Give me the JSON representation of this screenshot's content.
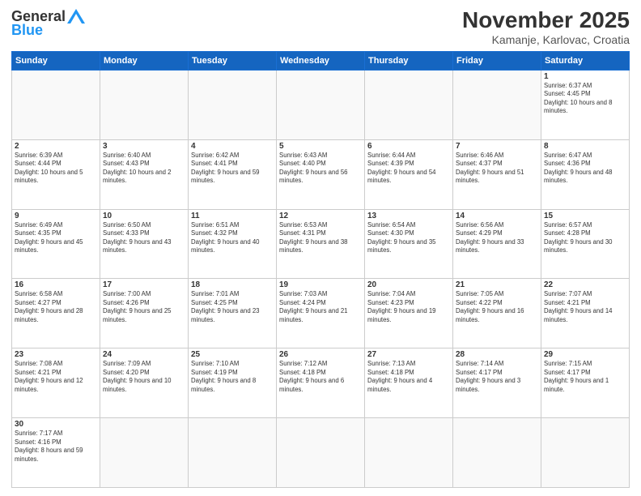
{
  "logo": {
    "general": "General",
    "blue": "Blue"
  },
  "title": {
    "month": "November 2025",
    "location": "Kamanje, Karlovac, Croatia"
  },
  "weekdays": [
    "Sunday",
    "Monday",
    "Tuesday",
    "Wednesday",
    "Thursday",
    "Friday",
    "Saturday"
  ],
  "weeks": [
    [
      {
        "day": "",
        "info": ""
      },
      {
        "day": "",
        "info": ""
      },
      {
        "day": "",
        "info": ""
      },
      {
        "day": "",
        "info": ""
      },
      {
        "day": "",
        "info": ""
      },
      {
        "day": "",
        "info": ""
      },
      {
        "day": "1",
        "info": "Sunrise: 6:37 AM\nSunset: 4:45 PM\nDaylight: 10 hours and 8 minutes."
      }
    ],
    [
      {
        "day": "2",
        "info": "Sunrise: 6:39 AM\nSunset: 4:44 PM\nDaylight: 10 hours and 5 minutes."
      },
      {
        "day": "3",
        "info": "Sunrise: 6:40 AM\nSunset: 4:43 PM\nDaylight: 10 hours and 2 minutes."
      },
      {
        "day": "4",
        "info": "Sunrise: 6:42 AM\nSunset: 4:41 PM\nDaylight: 9 hours and 59 minutes."
      },
      {
        "day": "5",
        "info": "Sunrise: 6:43 AM\nSunset: 4:40 PM\nDaylight: 9 hours and 56 minutes."
      },
      {
        "day": "6",
        "info": "Sunrise: 6:44 AM\nSunset: 4:39 PM\nDaylight: 9 hours and 54 minutes."
      },
      {
        "day": "7",
        "info": "Sunrise: 6:46 AM\nSunset: 4:37 PM\nDaylight: 9 hours and 51 minutes."
      },
      {
        "day": "8",
        "info": "Sunrise: 6:47 AM\nSunset: 4:36 PM\nDaylight: 9 hours and 48 minutes."
      }
    ],
    [
      {
        "day": "9",
        "info": "Sunrise: 6:49 AM\nSunset: 4:35 PM\nDaylight: 9 hours and 45 minutes."
      },
      {
        "day": "10",
        "info": "Sunrise: 6:50 AM\nSunset: 4:33 PM\nDaylight: 9 hours and 43 minutes."
      },
      {
        "day": "11",
        "info": "Sunrise: 6:51 AM\nSunset: 4:32 PM\nDaylight: 9 hours and 40 minutes."
      },
      {
        "day": "12",
        "info": "Sunrise: 6:53 AM\nSunset: 4:31 PM\nDaylight: 9 hours and 38 minutes."
      },
      {
        "day": "13",
        "info": "Sunrise: 6:54 AM\nSunset: 4:30 PM\nDaylight: 9 hours and 35 minutes."
      },
      {
        "day": "14",
        "info": "Sunrise: 6:56 AM\nSunset: 4:29 PM\nDaylight: 9 hours and 33 minutes."
      },
      {
        "day": "15",
        "info": "Sunrise: 6:57 AM\nSunset: 4:28 PM\nDaylight: 9 hours and 30 minutes."
      }
    ],
    [
      {
        "day": "16",
        "info": "Sunrise: 6:58 AM\nSunset: 4:27 PM\nDaylight: 9 hours and 28 minutes."
      },
      {
        "day": "17",
        "info": "Sunrise: 7:00 AM\nSunset: 4:26 PM\nDaylight: 9 hours and 25 minutes."
      },
      {
        "day": "18",
        "info": "Sunrise: 7:01 AM\nSunset: 4:25 PM\nDaylight: 9 hours and 23 minutes."
      },
      {
        "day": "19",
        "info": "Sunrise: 7:03 AM\nSunset: 4:24 PM\nDaylight: 9 hours and 21 minutes."
      },
      {
        "day": "20",
        "info": "Sunrise: 7:04 AM\nSunset: 4:23 PM\nDaylight: 9 hours and 19 minutes."
      },
      {
        "day": "21",
        "info": "Sunrise: 7:05 AM\nSunset: 4:22 PM\nDaylight: 9 hours and 16 minutes."
      },
      {
        "day": "22",
        "info": "Sunrise: 7:07 AM\nSunset: 4:21 PM\nDaylight: 9 hours and 14 minutes."
      }
    ],
    [
      {
        "day": "23",
        "info": "Sunrise: 7:08 AM\nSunset: 4:21 PM\nDaylight: 9 hours and 12 minutes."
      },
      {
        "day": "24",
        "info": "Sunrise: 7:09 AM\nSunset: 4:20 PM\nDaylight: 9 hours and 10 minutes."
      },
      {
        "day": "25",
        "info": "Sunrise: 7:10 AM\nSunset: 4:19 PM\nDaylight: 9 hours and 8 minutes."
      },
      {
        "day": "26",
        "info": "Sunrise: 7:12 AM\nSunset: 4:18 PM\nDaylight: 9 hours and 6 minutes."
      },
      {
        "day": "27",
        "info": "Sunrise: 7:13 AM\nSunset: 4:18 PM\nDaylight: 9 hours and 4 minutes."
      },
      {
        "day": "28",
        "info": "Sunrise: 7:14 AM\nSunset: 4:17 PM\nDaylight: 9 hours and 3 minutes."
      },
      {
        "day": "29",
        "info": "Sunrise: 7:15 AM\nSunset: 4:17 PM\nDaylight: 9 hours and 1 minute."
      }
    ],
    [
      {
        "day": "30",
        "info": "Sunrise: 7:17 AM\nSunset: 4:16 PM\nDaylight: 8 hours and 59 minutes."
      },
      {
        "day": "",
        "info": ""
      },
      {
        "day": "",
        "info": ""
      },
      {
        "day": "",
        "info": ""
      },
      {
        "day": "",
        "info": ""
      },
      {
        "day": "",
        "info": ""
      },
      {
        "day": "",
        "info": ""
      }
    ]
  ]
}
